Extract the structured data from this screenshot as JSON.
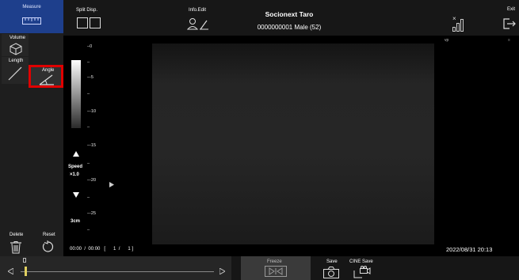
{
  "header": {
    "measure_label": "Measure",
    "split_label": "Split Disp.",
    "info_label": "Info.Edit",
    "patient_name": "Socionext Taro",
    "patient_info": "0000000001 Male (52)",
    "exit_label": "Exit",
    "signal_mark": "×"
  },
  "tools": {
    "volume_label": "Volume",
    "length_label": "Length",
    "angle_label": "Angle",
    "delete_label": "Delete",
    "reset_label": "Reset",
    "highlight_color": "#e00000"
  },
  "scale": {
    "ticks": [
      "0",
      "-5",
      "-10",
      "-15",
      "-20",
      "-25"
    ],
    "speed_label": "Speed",
    "speed_value": "×1.0",
    "depth": "3cm"
  },
  "image": {
    "vp_label": "vp",
    "playback_time": "00:00  /  00:00   [      1  /      1 ]",
    "datetime": "2022/08/31 20:13"
  },
  "footer": {
    "freeze_label": "Freeze",
    "save_label": "Save",
    "cine_label": "CINE Save"
  }
}
